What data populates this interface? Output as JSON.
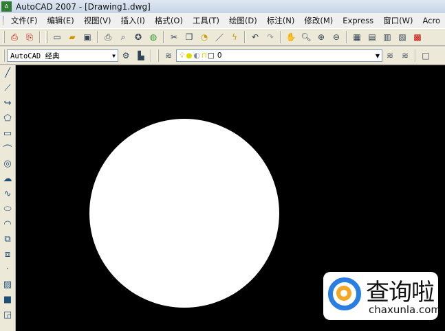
{
  "title": "AutoCAD 2007 - [Drawing1.dwg]",
  "menu": [
    "文件(F)",
    "编辑(E)",
    "视图(V)",
    "插入(I)",
    "格式(O)",
    "工具(T)",
    "绘图(D)",
    "标注(N)",
    "修改(M)",
    "Express",
    "窗口(W)",
    "Acro"
  ],
  "workspace": {
    "value": "AutoCAD 经典"
  },
  "layer": {
    "value": "0"
  },
  "watermark": {
    "text": "查询啦",
    "url": "chaxunla.com"
  }
}
